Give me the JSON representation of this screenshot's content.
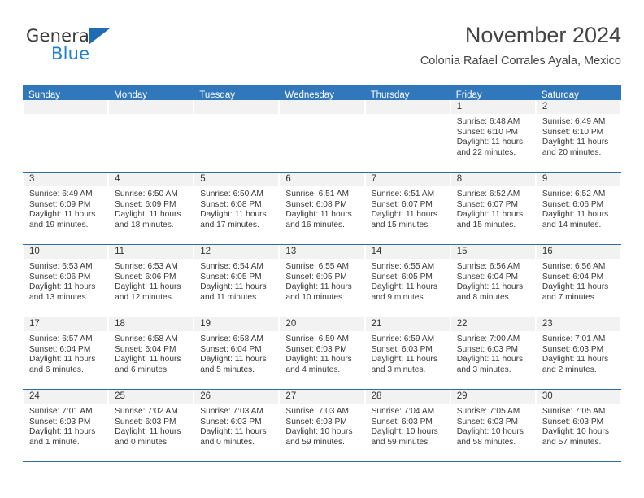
{
  "brand": {
    "name_part1": "General",
    "name_part2": "Blue",
    "triangle_color": "#1f6cb4",
    "blue_text_color": "#1b7fd4"
  },
  "header": {
    "title": "November 2024",
    "subtitle": "Colonia Rafael Corrales Ayala, Mexico"
  },
  "theme": {
    "header_bar_color": "#3077bc",
    "row_divider_color": "#2e6da4",
    "day_band_color": "#f2f2f2"
  },
  "weekdays": [
    "Sunday",
    "Monday",
    "Tuesday",
    "Wednesday",
    "Thursday",
    "Friday",
    "Saturday"
  ],
  "weeks": [
    [
      {
        "day": "",
        "empty": true
      },
      {
        "day": "",
        "empty": true
      },
      {
        "day": "",
        "empty": true
      },
      {
        "day": "",
        "empty": true
      },
      {
        "day": "",
        "empty": true
      },
      {
        "day": "1",
        "sunrise": "Sunrise: 6:48 AM",
        "sunset": "Sunset: 6:10 PM",
        "daylight1": "Daylight: 11 hours",
        "daylight2": "and 22 minutes."
      },
      {
        "day": "2",
        "sunrise": "Sunrise: 6:49 AM",
        "sunset": "Sunset: 6:10 PM",
        "daylight1": "Daylight: 11 hours",
        "daylight2": "and 20 minutes."
      }
    ],
    [
      {
        "day": "3",
        "sunrise": "Sunrise: 6:49 AM",
        "sunset": "Sunset: 6:09 PM",
        "daylight1": "Daylight: 11 hours",
        "daylight2": "and 19 minutes."
      },
      {
        "day": "4",
        "sunrise": "Sunrise: 6:50 AM",
        "sunset": "Sunset: 6:09 PM",
        "daylight1": "Daylight: 11 hours",
        "daylight2": "and 18 minutes."
      },
      {
        "day": "5",
        "sunrise": "Sunrise: 6:50 AM",
        "sunset": "Sunset: 6:08 PM",
        "daylight1": "Daylight: 11 hours",
        "daylight2": "and 17 minutes."
      },
      {
        "day": "6",
        "sunrise": "Sunrise: 6:51 AM",
        "sunset": "Sunset: 6:08 PM",
        "daylight1": "Daylight: 11 hours",
        "daylight2": "and 16 minutes."
      },
      {
        "day": "7",
        "sunrise": "Sunrise: 6:51 AM",
        "sunset": "Sunset: 6:07 PM",
        "daylight1": "Daylight: 11 hours",
        "daylight2": "and 15 minutes."
      },
      {
        "day": "8",
        "sunrise": "Sunrise: 6:52 AM",
        "sunset": "Sunset: 6:07 PM",
        "daylight1": "Daylight: 11 hours",
        "daylight2": "and 15 minutes."
      },
      {
        "day": "9",
        "sunrise": "Sunrise: 6:52 AM",
        "sunset": "Sunset: 6:06 PM",
        "daylight1": "Daylight: 11 hours",
        "daylight2": "and 14 minutes."
      }
    ],
    [
      {
        "day": "10",
        "sunrise": "Sunrise: 6:53 AM",
        "sunset": "Sunset: 6:06 PM",
        "daylight1": "Daylight: 11 hours",
        "daylight2": "and 13 minutes."
      },
      {
        "day": "11",
        "sunrise": "Sunrise: 6:53 AM",
        "sunset": "Sunset: 6:06 PM",
        "daylight1": "Daylight: 11 hours",
        "daylight2": "and 12 minutes."
      },
      {
        "day": "12",
        "sunrise": "Sunrise: 6:54 AM",
        "sunset": "Sunset: 6:05 PM",
        "daylight1": "Daylight: 11 hours",
        "daylight2": "and 11 minutes."
      },
      {
        "day": "13",
        "sunrise": "Sunrise: 6:55 AM",
        "sunset": "Sunset: 6:05 PM",
        "daylight1": "Daylight: 11 hours",
        "daylight2": "and 10 minutes."
      },
      {
        "day": "14",
        "sunrise": "Sunrise: 6:55 AM",
        "sunset": "Sunset: 6:05 PM",
        "daylight1": "Daylight: 11 hours",
        "daylight2": "and 9 minutes."
      },
      {
        "day": "15",
        "sunrise": "Sunrise: 6:56 AM",
        "sunset": "Sunset: 6:04 PM",
        "daylight1": "Daylight: 11 hours",
        "daylight2": "and 8 minutes."
      },
      {
        "day": "16",
        "sunrise": "Sunrise: 6:56 AM",
        "sunset": "Sunset: 6:04 PM",
        "daylight1": "Daylight: 11 hours",
        "daylight2": "and 7 minutes."
      }
    ],
    [
      {
        "day": "17",
        "sunrise": "Sunrise: 6:57 AM",
        "sunset": "Sunset: 6:04 PM",
        "daylight1": "Daylight: 11 hours",
        "daylight2": "and 6 minutes."
      },
      {
        "day": "18",
        "sunrise": "Sunrise: 6:58 AM",
        "sunset": "Sunset: 6:04 PM",
        "daylight1": "Daylight: 11 hours",
        "daylight2": "and 6 minutes."
      },
      {
        "day": "19",
        "sunrise": "Sunrise: 6:58 AM",
        "sunset": "Sunset: 6:04 PM",
        "daylight1": "Daylight: 11 hours",
        "daylight2": "and 5 minutes."
      },
      {
        "day": "20",
        "sunrise": "Sunrise: 6:59 AM",
        "sunset": "Sunset: 6:03 PM",
        "daylight1": "Daylight: 11 hours",
        "daylight2": "and 4 minutes."
      },
      {
        "day": "21",
        "sunrise": "Sunrise: 6:59 AM",
        "sunset": "Sunset: 6:03 PM",
        "daylight1": "Daylight: 11 hours",
        "daylight2": "and 3 minutes."
      },
      {
        "day": "22",
        "sunrise": "Sunrise: 7:00 AM",
        "sunset": "Sunset: 6:03 PM",
        "daylight1": "Daylight: 11 hours",
        "daylight2": "and 3 minutes."
      },
      {
        "day": "23",
        "sunrise": "Sunrise: 7:01 AM",
        "sunset": "Sunset: 6:03 PM",
        "daylight1": "Daylight: 11 hours",
        "daylight2": "and 2 minutes."
      }
    ],
    [
      {
        "day": "24",
        "sunrise": "Sunrise: 7:01 AM",
        "sunset": "Sunset: 6:03 PM",
        "daylight1": "Daylight: 11 hours",
        "daylight2": "and 1 minute."
      },
      {
        "day": "25",
        "sunrise": "Sunrise: 7:02 AM",
        "sunset": "Sunset: 6:03 PM",
        "daylight1": "Daylight: 11 hours",
        "daylight2": "and 0 minutes."
      },
      {
        "day": "26",
        "sunrise": "Sunrise: 7:03 AM",
        "sunset": "Sunset: 6:03 PM",
        "daylight1": "Daylight: 11 hours",
        "daylight2": "and 0 minutes."
      },
      {
        "day": "27",
        "sunrise": "Sunrise: 7:03 AM",
        "sunset": "Sunset: 6:03 PM",
        "daylight1": "Daylight: 10 hours",
        "daylight2": "and 59 minutes."
      },
      {
        "day": "28",
        "sunrise": "Sunrise: 7:04 AM",
        "sunset": "Sunset: 6:03 PM",
        "daylight1": "Daylight: 10 hours",
        "daylight2": "and 59 minutes."
      },
      {
        "day": "29",
        "sunrise": "Sunrise: 7:05 AM",
        "sunset": "Sunset: 6:03 PM",
        "daylight1": "Daylight: 10 hours",
        "daylight2": "and 58 minutes."
      },
      {
        "day": "30",
        "sunrise": "Sunrise: 7:05 AM",
        "sunset": "Sunset: 6:03 PM",
        "daylight1": "Daylight: 10 hours",
        "daylight2": "and 57 minutes."
      }
    ]
  ]
}
